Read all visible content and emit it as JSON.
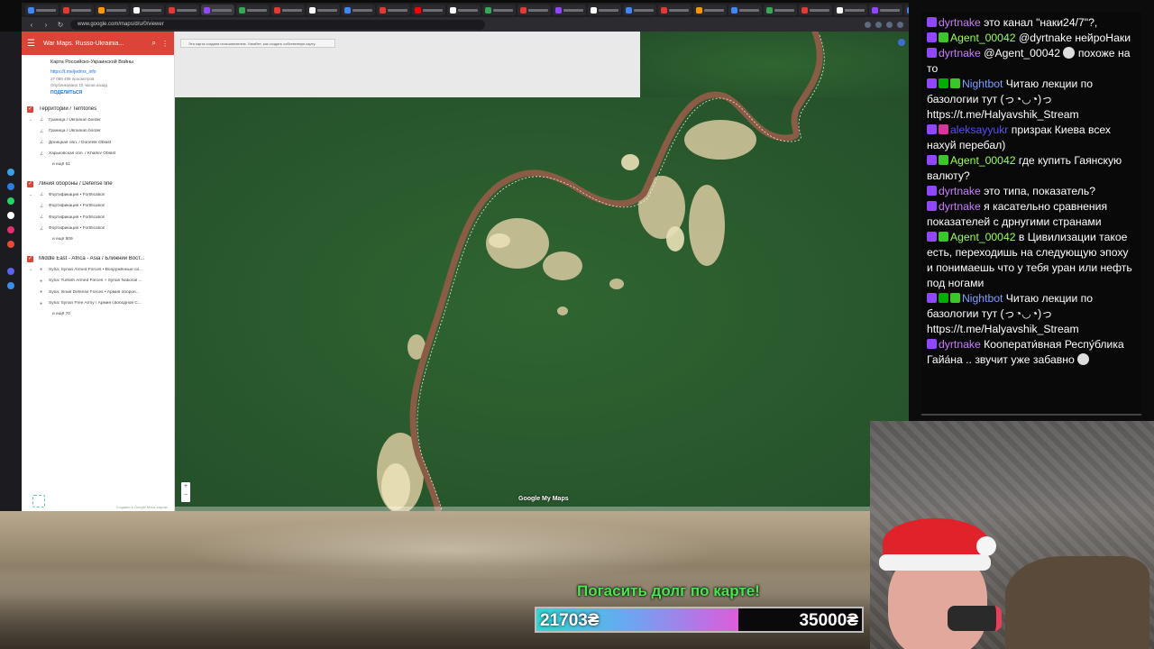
{
  "browser": {
    "url": "www.google.com/maps/d/u/0/viewer"
  },
  "map_panel": {
    "title": "War Maps. Russo-Ukrainia...",
    "map_name": "Карта Российско-Украинской Войны",
    "link": "https://t.me/jednrs_info",
    "views": "27 089 499 просмотров",
    "published": "Опубликовано 10 часов назад",
    "share": "ПОДЕЛИТЬСЯ",
    "footer": "Создано в Google Моих картах",
    "layers": [
      {
        "title": "Территории / Territories",
        "items": [
          "Граница / Ukrainian border",
          "Граница / Ukrainian border",
          "Донецкая обл. / Donetsk Oblast",
          "Харьковская обл. / Kharkiv Oblast"
        ],
        "more": "и ещё 51"
      },
      {
        "title": "Линия обороны / Defense line",
        "items": [
          "Фортификация • Fortification",
          "Фортификация • Fortification",
          "Фортификация • Fortification",
          "Фортификация • Fortification"
        ],
        "more": "и ещё 809"
      },
      {
        "title": "Middle East - Africa - Asia / Ближний Вост...",
        "items": [
          "Syria: Syrian Armed Forces • Вооружённые си...",
          "Syria: Turkish Armed Forces + Syrian National ...",
          "Syria: Israel Defense Forces • Армия оборон...",
          "Syria: Syrian Free Army / Армия свободной С..."
        ],
        "more": "и ещё 70"
      }
    ]
  },
  "map": {
    "notice": "Эта карта создана пользователем. Узнайте, как создать собственную карту.",
    "logo": "Google My Maps",
    "zoom_in": "+",
    "zoom_out": "−"
  },
  "donation": {
    "title": "Погасить долг по карте!",
    "current": "21703₴",
    "goal": "35000₴",
    "progress": 0.62
  },
  "chat": [
    {
      "user": "dyrtnake",
      "color": "#c97dff",
      "badges": [
        "b-twitch"
      ],
      "text": "это канал \"наки24/7\"?,"
    },
    {
      "user": "Agent_00042",
      "color": "#9aff5a",
      "badges": [
        "b-twitch",
        "b-sub"
      ],
      "text": "@dyrtnake нейроНаки"
    },
    {
      "user": "dyrtnake",
      "color": "#c97dff",
      "badges": [
        "b-twitch"
      ],
      "text": "@Agent_00042",
      "emote": true,
      "text2": "похоже на то"
    },
    {
      "user": "Nightbot",
      "color": "#7f9dff",
      "badges": [
        "b-twitch",
        "b-mod",
        "b-sub"
      ],
      "text": "Читаю лекции по базологии тут (っ◔◡◔)っ https://t.me/Halyavshik_Stream"
    },
    {
      "user": "aleksayyukr",
      "color": "#5c4dff",
      "badges": [
        "b-twitch",
        "b-vip"
      ],
      "text": "призрак Киева всех нахуй перебал)"
    },
    {
      "user": "Agent_00042",
      "color": "#9aff5a",
      "badges": [
        "b-twitch",
        "b-sub"
      ],
      "text": "где купить Гаянскую валюту?"
    },
    {
      "user": "dyrtnake",
      "color": "#c97dff",
      "badges": [
        "b-twitch"
      ],
      "text": "это типа, показатель?"
    },
    {
      "user": "dyrtnake",
      "color": "#c97dff",
      "badges": [
        "b-twitch"
      ],
      "text": "я касательно сравнения показателей с дрнугими странами"
    },
    {
      "user": "Agent_00042",
      "color": "#9aff5a",
      "badges": [
        "b-twitch",
        "b-sub"
      ],
      "text": "в Цивилизации такое есть, переходишь на следующую эпоху и понимаешь что у тебя уран или нефть под ногами"
    },
    {
      "user": "Nightbot",
      "color": "#7f9dff",
      "badges": [
        "b-twitch",
        "b-mod",
        "b-sub"
      ],
      "text": "Читаю лекции по базологии тут (っ◔◡◔)っ https://t.me/Halyavshik_Stream"
    },
    {
      "user": "dyrtnake",
      "color": "#c97dff",
      "badges": [
        "b-twitch"
      ],
      "text": "Кооперати́вная Респу́блика Гайа́на .. звучит уже забавно",
      "emote_end": true
    }
  ],
  "colors": {
    "panel_header": "#db4437",
    "donation_text": "#49e64f",
    "map_green": "#2b5a2e",
    "river": "#8a5b45"
  }
}
